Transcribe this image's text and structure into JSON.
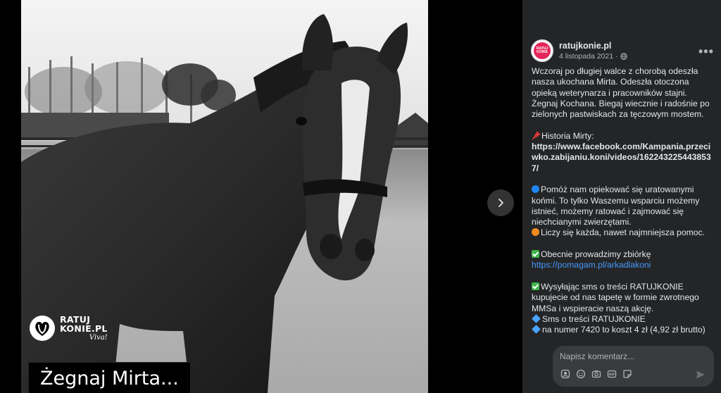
{
  "photo": {
    "brand_line1": "RATUJ",
    "brand_line2": "KONIE.PL",
    "brand_tag": "Viva!",
    "caption": "Żegnaj Mirta..."
  },
  "post": {
    "page_name": "ratujkonie.pl",
    "avatar_text": "RATUJ KONIE",
    "date": "4 listopada 2021",
    "more_icon": "more-dots-icon",
    "privacy_icon": "globe-icon",
    "paragraphs": {
      "p1": "Wczoraj po długiej walce z chorobą odeszła nasza ukochana Mirta. Odeszła otoczona opieką weterynarza i pracowników stajni. Żegnaj Kochana. Biegaj wiecznie i radośnie po zielonych pastwiskach za tęczowym mostem.",
      "history_label": "Historia Mirty:",
      "history_link": "https://www.facebook.com/Kampania.przeciwko.zabijaniu.koni/videos/1622432254438537/",
      "help1": "Pomóż nam opiekować się uratowanymi końmi. To tylko Waszemu wsparciu możemy istnieć, możemy ratować i zajmować się niechcianymi zwierzętami.",
      "help2": "Liczy się każda, nawet najmniejsza pomoc.",
      "fundraiser_label": "Obecnie prowadzimy zbiórkę",
      "fundraiser_link": "https://pomagam.pl/arkadlakoni",
      "sms1": "Wysyłając sms o treści RATUJKONIE kupujecie od nas tapetę w formie zwrotnego MMSa i wspieracie naszą akcję.",
      "sms2": "Sms o treści RATUJKONIE",
      "sms3": "na numer 7420 to koszt 4 zł (4,92 zł brutto)"
    }
  },
  "comment": {
    "placeholder": "Napisz komentarz..."
  },
  "colors": {
    "panel_bg": "#242526",
    "link": "#4599ff",
    "brand_pink": "#e4245a"
  }
}
